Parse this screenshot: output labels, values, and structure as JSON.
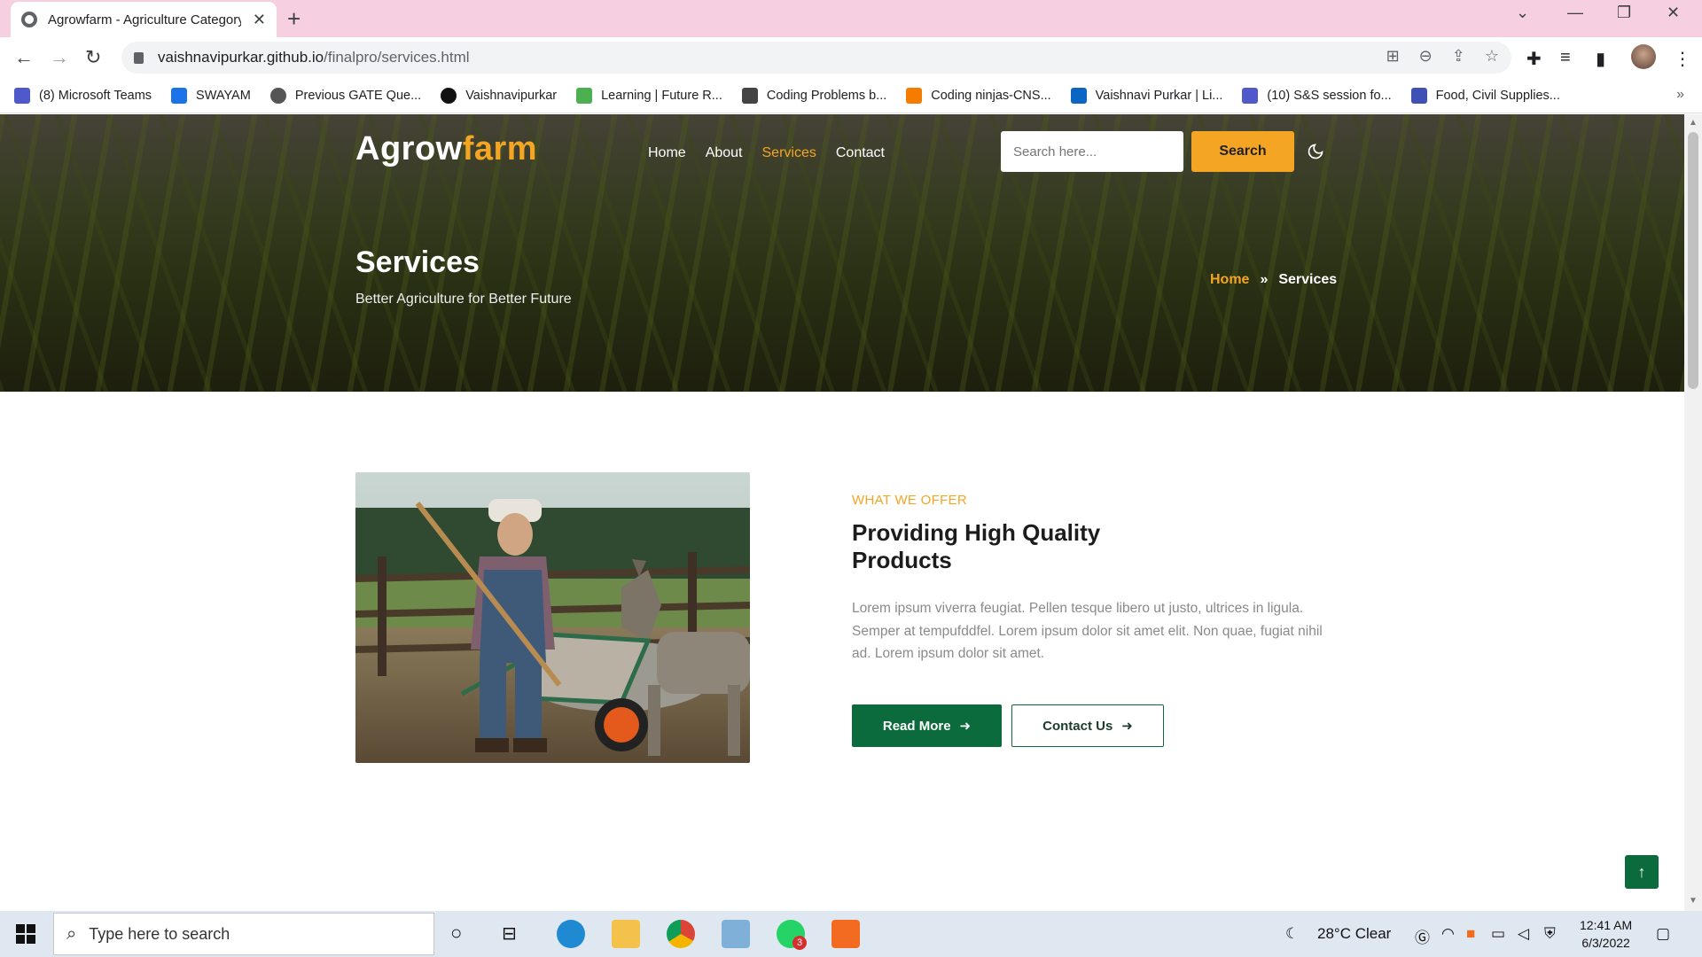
{
  "browser": {
    "tab_title": "Agrowfarm - Agriculture Category",
    "url_host": "vaishnavipurkar.github.io",
    "url_path": "/finalpro/services.html",
    "bookmarks": [
      {
        "label": "(8) Microsoft Teams",
        "color": "#5059c9"
      },
      {
        "label": "SWAYAM",
        "color": "#1a73e8"
      },
      {
        "label": "Previous GATE Que...",
        "color": "#555555"
      },
      {
        "label": "Vaishnavipurkar",
        "color": "#111111"
      },
      {
        "label": "Learning | Future R...",
        "color": "#4caf50"
      },
      {
        "label": "Coding Problems b...",
        "color": "#444444"
      },
      {
        "label": "Coding ninjas-CNS...",
        "color": "#f57c00"
      },
      {
        "label": "Vaishnavi Purkar | Li...",
        "color": "#0a66c2"
      },
      {
        "label": "(10) S&S session fo...",
        "color": "#5059c9"
      },
      {
        "label": "Food, Civil Supplies...",
        "color": "#3f51b5"
      }
    ]
  },
  "site": {
    "logo_main": "Agrow",
    "logo_accent": "farm",
    "nav": [
      "Home",
      "About",
      "Services",
      "Contact"
    ],
    "active_nav": "Services",
    "search_placeholder": "Search here...",
    "search_button": "Search"
  },
  "hero": {
    "title": "Services",
    "subtitle": "Better Agriculture for Better Future",
    "breadcrumb_home": "Home",
    "breadcrumb_sep": "»",
    "breadcrumb_current": "Services"
  },
  "offer": {
    "eyebrow": "WHAT WE OFFER",
    "heading": "Providing High Quality Products",
    "paragraph": "Lorem ipsum viverra feugiat. Pellen tesque libero ut justo, ultrices in ligula. Semper at tempufddfel. Lorem ipsum dolor sit amet elit. Non quae, fugiat nihil ad. Lorem ipsum dolor sit amet.",
    "read_more": "Read More",
    "contact_us": "Contact Us"
  },
  "taskbar": {
    "search_placeholder": "Type here to search",
    "weather": "28°C  Clear",
    "time": "12:41 AM",
    "date": "6/3/2022",
    "whatsapp_badge": "3"
  },
  "colors": {
    "accent": "#f5a524",
    "primary_green": "#0c6b3c",
    "tab_strip": "#f6cfe0"
  }
}
